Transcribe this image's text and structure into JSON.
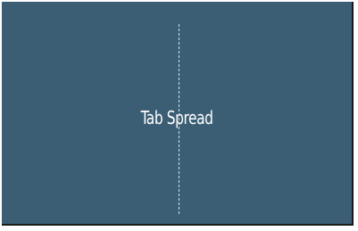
{
  "spread": {
    "label": "Tab Spread"
  },
  "colors": {
    "panel_background": "#3b5e75",
    "fold_line": "#d6e2ea",
    "label_text": "#ffffff"
  }
}
